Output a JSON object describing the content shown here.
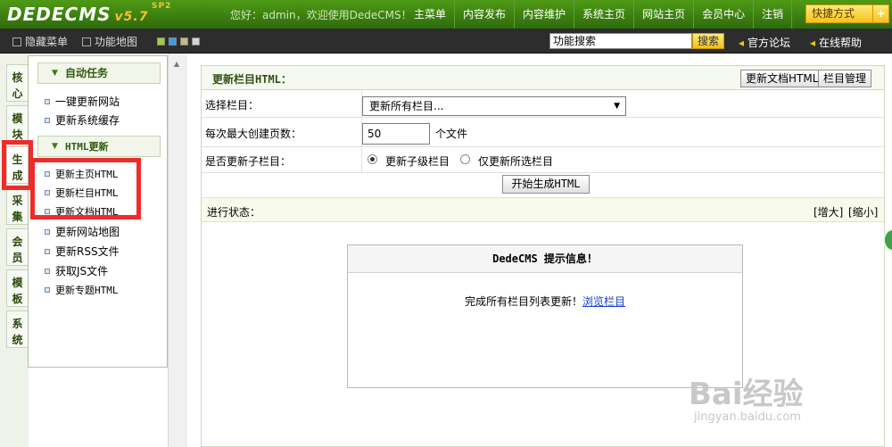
{
  "header": {
    "logo_text": "DEDECMS",
    "version": "v5.7",
    "version_tag": "SP2",
    "welcome": "您好：admin，欢迎使用DedeCMS！",
    "nav": [
      "主菜单",
      "内容发布",
      "内容维护",
      "系统主页",
      "网站主页",
      "会员中心",
      "注销"
    ],
    "quick_label": "快捷方式",
    "quick_plus": "+"
  },
  "subbar": {
    "hide_menu": "隐藏菜单",
    "site_map": "功能地图",
    "search_value": "功能搜索",
    "search_button": "搜索",
    "forum": "官方论坛",
    "help": "在线帮助",
    "swatch_colors": [
      "#9ad13a",
      "#3a9de0",
      "#c8b98a",
      "#d4d4d4"
    ]
  },
  "vtabs": [
    "核心",
    "模块",
    "生成",
    "采集",
    "会员",
    "模板",
    "系统"
  ],
  "leftmenu": {
    "group1_title": "自动任务",
    "group1_items": [
      "一键更新网站",
      "更新系统缓存"
    ],
    "group2_title": "HTML更新",
    "group2_items": [
      "更新主页HTML",
      "更新栏目HTML",
      "更新文档HTML",
      "更新网站地图",
      "更新RSS文件",
      "获取JS文件",
      "更新专题HTML"
    ]
  },
  "main": {
    "title": "更新栏目HTML：",
    "btn_update_docs": "更新文档HTML",
    "btn_manage": "栏目管理",
    "row1_label": "选择栏目：",
    "select_value": "更新所有栏目...",
    "row2_label": "每次最大创建页数：",
    "pages_value": "50",
    "pages_unit": "个文件",
    "row3_label": "是否更新子栏目：",
    "radio1": "更新子级栏目",
    "radio2": "仅更新所选栏目",
    "start_button": "开始生成HTML",
    "status_label": "进行状态：",
    "enlarge": "[增大]",
    "shrink": "[缩小]"
  },
  "message": {
    "title": "DedeCMS 提示信息！",
    "text": "完成所有栏目列表更新！",
    "link": "浏览栏目"
  },
  "watermark": {
    "line1": "Bai经验",
    "line2": "jingyan.baidu.com"
  },
  "colors": {
    "header_green": "#3d7d10",
    "highlight_red": "#ef2b2b",
    "quick_yellow": "#f5c21b"
  }
}
